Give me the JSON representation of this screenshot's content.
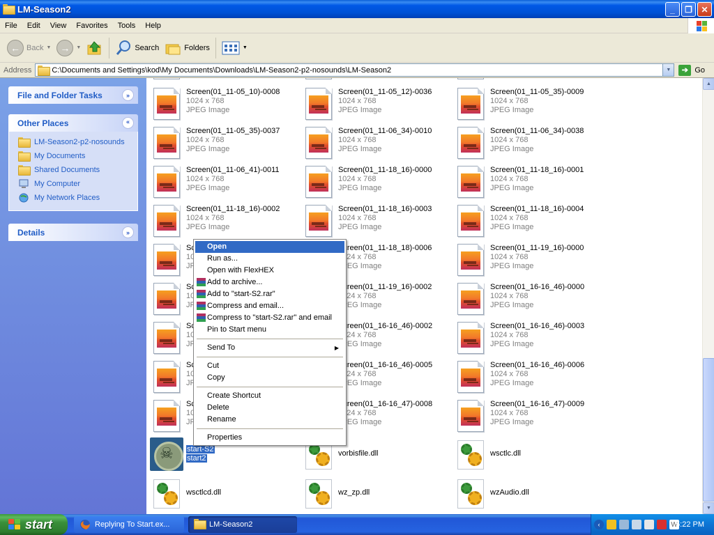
{
  "window": {
    "title": "LM-Season2"
  },
  "menubar": [
    "File",
    "Edit",
    "View",
    "Favorites",
    "Tools",
    "Help"
  ],
  "toolbar": {
    "back": "Back",
    "search": "Search",
    "folders": "Folders"
  },
  "address": {
    "label": "Address",
    "value": "C:\\Documents and Settings\\kod\\My Documents\\Downloads\\LM-Season2-p2-nosounds\\LM-Season2",
    "go": "Go"
  },
  "taskpane": {
    "file_tasks": "File and Folder Tasks",
    "other_places": {
      "title": "Other Places",
      "items": [
        "LM-Season2-p2-nosounds",
        "My Documents",
        "Shared Documents",
        "My Computer",
        "My Network Places"
      ]
    },
    "details": "Details"
  },
  "files": {
    "r0c0": {
      "name": "Screen(01_11-05_10)-0008",
      "dim": "1024 x 768",
      "type": "JPEG Image"
    },
    "r0c1": {
      "name": "Screen(01_11-05_12)-0036",
      "dim": "1024 x 768",
      "type": "JPEG Image"
    },
    "r0c2": {
      "name": "Screen(01_11-05_35)-0009",
      "dim": "1024 x 768",
      "type": "JPEG Image"
    },
    "r1c0": {
      "name": "Screen(01_11-05_35)-0037",
      "dim": "1024 x 768",
      "type": "JPEG Image"
    },
    "r1c1": {
      "name": "Screen(01_11-06_34)-0010",
      "dim": "1024 x 768",
      "type": "JPEG Image"
    },
    "r1c2": {
      "name": "Screen(01_11-06_34)-0038",
      "dim": "1024 x 768",
      "type": "JPEG Image"
    },
    "r2c0": {
      "name": "Screen(01_11-06_41)-0011",
      "dim": "1024 x 768",
      "type": "JPEG Image"
    },
    "r2c1": {
      "name": "Screen(01_11-18_16)-0000",
      "dim": "1024 x 768",
      "type": "JPEG Image"
    },
    "r2c2": {
      "name": "Screen(01_11-18_16)-0001",
      "dim": "1024 x 768",
      "type": "JPEG Image"
    },
    "r3c0": {
      "name": "Screen(01_11-18_16)-0002",
      "dim": "1024 x 768",
      "type": "JPEG Image"
    },
    "r3c1": {
      "name": "Screen(01_11-18_16)-0003",
      "dim": "1024 x 768",
      "type": "JPEG Image"
    },
    "r3c2": {
      "name": "Screen(01_11-18_16)-0004",
      "dim": "1024 x 768",
      "type": "JPEG Image"
    },
    "r4c0": {
      "name": "Sc",
      "dim": "1024",
      "type": "JP"
    },
    "r4c1": {
      "name": "Screen(01_11-18_18)-0006",
      "dim": "1024 x 768",
      "type": "JPEG Image"
    },
    "r4c2": {
      "name": "Screen(01_11-19_16)-0000",
      "dim": "1024 x 768",
      "type": "JPEG Image"
    },
    "r5c0": {
      "name": "Sc",
      "dim": "1024",
      "type": "JP"
    },
    "r5c1": {
      "name": "Screen(01_11-19_16)-0002",
      "dim": "1024 x 768",
      "type": "JPEG Image"
    },
    "r5c2": {
      "name": "Screen(01_16-16_46)-0000",
      "dim": "1024 x 768",
      "type": "JPEG Image"
    },
    "r6c0": {
      "name": "Sc",
      "dim": "1024",
      "type": "JP"
    },
    "r6c1": {
      "name": "Screen(01_16-16_46)-0002",
      "dim": "1024 x 768",
      "type": "JPEG Image"
    },
    "r6c2": {
      "name": "Screen(01_16-16_46)-0003",
      "dim": "1024 x 768",
      "type": "JPEG Image"
    },
    "r7c0": {
      "name": "Sc",
      "dim": "1024",
      "type": "JP"
    },
    "r7c1": {
      "name": "Screen(01_16-16_46)-0005",
      "dim": "1024 x 768",
      "type": "JPEG Image"
    },
    "r7c2": {
      "name": "Screen(01_16-16_46)-0006",
      "dim": "1024 x 768",
      "type": "JPEG Image"
    },
    "r8c0": {
      "name": "Sc",
      "dim": "1024",
      "type": "JP"
    },
    "r8c1": {
      "name": "Screen(01_16-16_47)-0008",
      "dim": "1024 x 768",
      "type": "JPEG Image"
    },
    "r8c2": {
      "name": "Screen(01_16-16_47)-0009",
      "dim": "1024 x 768",
      "type": "JPEG Image"
    },
    "sel_line1": "start-S2",
    "sel_line2": "start2",
    "vorbis": "vorbisfile.dll",
    "wsctlc": "wsctlc.dll",
    "wsctlcd": "wsctlcd.dll",
    "wzzp": "wz_zp.dll",
    "wzaudio": "wzAudio.dll"
  },
  "context_menu": {
    "open": "Open",
    "run_as": "Run as...",
    "open_flexhex": "Open with FlexHEX",
    "add_archive": "Add to archive...",
    "add_rar": "Add to \"start-S2.rar\"",
    "compress_email": "Compress and email...",
    "compress_rar_email": "Compress to \"start-S2.rar\" and email",
    "pin_start": "Pin to Start menu",
    "send_to": "Send To",
    "cut": "Cut",
    "copy": "Copy",
    "create_shortcut": "Create Shortcut",
    "delete": "Delete",
    "rename": "Rename",
    "properties": "Properties"
  },
  "taskbar": {
    "start": "start",
    "tasks": [
      "Replying To Start.ex...",
      "LM-Season2"
    ],
    "clock": "5:22 PM"
  },
  "colors": {
    "titlebar": "#0054e3",
    "selection": "#316ac5",
    "taskpane": "#7ba2e7",
    "start": "#3c9a3c"
  }
}
